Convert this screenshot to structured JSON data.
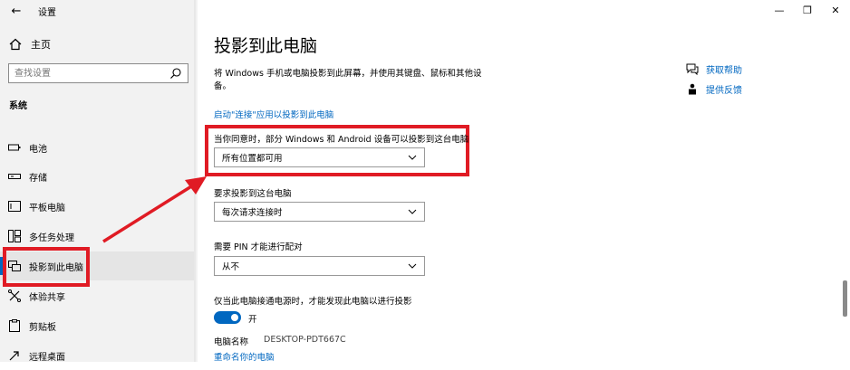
{
  "window": {
    "back_glyph": "←",
    "title": "设置",
    "minimize_glyph": "—",
    "maximize_glyph": "❐",
    "close_glyph": "✕"
  },
  "sidebar": {
    "home_label": "主页",
    "search_placeholder": "查找设置",
    "section_label": "系统",
    "items": [
      {
        "label": "电池",
        "icon": "battery-icon"
      },
      {
        "label": "存储",
        "icon": "storage-icon"
      },
      {
        "label": "平板电脑",
        "icon": "tablet-icon"
      },
      {
        "label": "多任务处理",
        "icon": "multitasking-icon"
      },
      {
        "label": "投影到此电脑",
        "icon": "projecting-icon",
        "active": true
      },
      {
        "label": "体验共享",
        "icon": "shared-experiences-icon"
      },
      {
        "label": "剪贴板",
        "icon": "clipboard-icon"
      },
      {
        "label": "远程桌面",
        "icon": "remote-desktop-icon"
      }
    ]
  },
  "main": {
    "title": "投影到此电脑",
    "description": "将 Windows 手机或电脑投影到此屏幕，并使用其键盘、鼠标和其他设备。",
    "launch_link": "启动\"连接\"应用以投影到此电脑",
    "setting1_label": "当你同意时，部分 Windows 和 Android 设备可以投影到这台电脑",
    "setting1_value": "所有位置都可用",
    "setting2_label": "要求投影到这台电脑",
    "setting2_value": "每次请求连接时",
    "setting3_label": "需要 PIN 才能进行配对",
    "setting3_value": "从不",
    "power_label": "仅当此电脑接通电源时，才能发现此电脑以进行投影",
    "toggle_state": "开",
    "pc_name_label": "电脑名称",
    "pc_name_value": "DESKTOP-PDT667C",
    "rename_link": "重命名你的电脑"
  },
  "help": {
    "get_help": "获取帮助",
    "feedback": "提供反馈"
  },
  "colors": {
    "accent": "#0067c0",
    "highlight": "#e01b24"
  }
}
